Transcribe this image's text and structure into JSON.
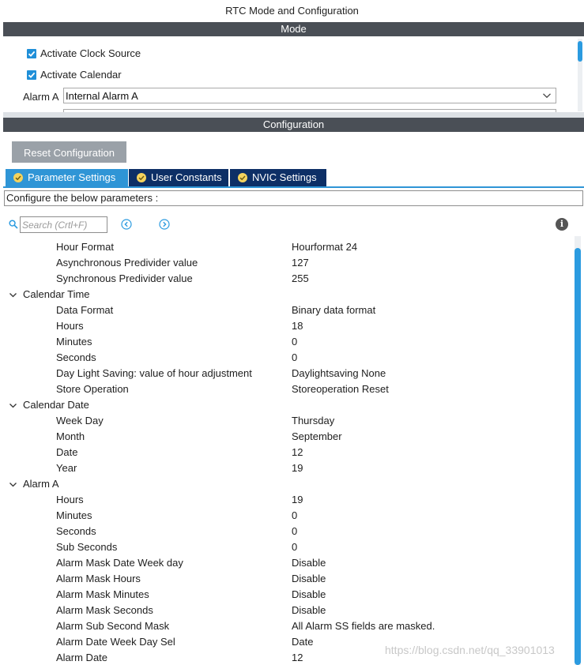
{
  "window": {
    "title": "RTC Mode and Configuration"
  },
  "mode": {
    "header": "Mode",
    "activate_clock_source": {
      "label": "Activate Clock Source",
      "checked": true
    },
    "activate_calendar": {
      "label": "Activate Calendar",
      "checked": true
    },
    "alarm_a": {
      "label": "Alarm A",
      "value": "Internal Alarm A"
    }
  },
  "configuration": {
    "header": "Configuration",
    "reset_label": "Reset Configuration",
    "tabs": [
      {
        "label": "Parameter Settings",
        "active": true
      },
      {
        "label": "User Constants",
        "active": false
      },
      {
        "label": "NVIC Settings",
        "active": false
      }
    ],
    "description": "Configure the below parameters :",
    "search_placeholder": "Search (Crtl+F)"
  },
  "parameters": [
    {
      "type": "item",
      "name": "Hour Format",
      "value": "Hourformat 24"
    },
    {
      "type": "item",
      "name": "Asynchronous Predivider value",
      "value": "127"
    },
    {
      "type": "item",
      "name": "Synchronous Predivider value",
      "value": "255"
    },
    {
      "type": "group",
      "name": "Calendar Time"
    },
    {
      "type": "item",
      "name": "Data Format",
      "value": "Binary data format"
    },
    {
      "type": "item",
      "name": "Hours",
      "value": "18"
    },
    {
      "type": "item",
      "name": "Minutes",
      "value": "0"
    },
    {
      "type": "item",
      "name": "Seconds",
      "value": "0"
    },
    {
      "type": "item",
      "name": "Day Light Saving: value of hour adjustment",
      "value": "Daylightsaving None"
    },
    {
      "type": "item",
      "name": "Store Operation",
      "value": "Storeoperation Reset"
    },
    {
      "type": "group",
      "name": "Calendar Date"
    },
    {
      "type": "item",
      "name": "Week Day",
      "value": "Thursday"
    },
    {
      "type": "item",
      "name": "Month",
      "value": "September"
    },
    {
      "type": "item",
      "name": "Date",
      "value": "12"
    },
    {
      "type": "item",
      "name": "Year",
      "value": "19"
    },
    {
      "type": "group",
      "name": "Alarm A"
    },
    {
      "type": "item",
      "name": "Hours",
      "value": "19"
    },
    {
      "type": "item",
      "name": "Minutes",
      "value": "0"
    },
    {
      "type": "item",
      "name": "Seconds",
      "value": "0"
    },
    {
      "type": "item",
      "name": "Sub Seconds",
      "value": "0"
    },
    {
      "type": "item",
      "name": "Alarm Mask Date Week day",
      "value": "Disable"
    },
    {
      "type": "item",
      "name": "Alarm Mask Hours",
      "value": "Disable"
    },
    {
      "type": "item",
      "name": "Alarm Mask Minutes",
      "value": "Disable"
    },
    {
      "type": "item",
      "name": "Alarm Mask Seconds",
      "value": "Disable"
    },
    {
      "type": "item",
      "name": "Alarm Sub Second Mask",
      "value": "All Alarm SS fields are masked."
    },
    {
      "type": "item",
      "name": "Alarm Date Week Day Sel",
      "value": "Date"
    },
    {
      "type": "item",
      "name": "Alarm Date",
      "value": "12"
    }
  ],
  "watermark": "https://blog.csdn.net/qq_33901013",
  "colors": {
    "accent": "#2b9be0",
    "header_bar": "#4a4f56",
    "tab_active": "#2f95d6",
    "tab_inactive": "#0d2f66",
    "tab_ok": "#f4d35e"
  },
  "icons": {
    "checkbox": "check-icon",
    "dropdown": "chevron-down-icon",
    "search": "search-icon",
    "prev": "prev-arrow-icon",
    "next": "next-arrow-icon",
    "info": "info-icon",
    "group_toggle": "chevron-down-icon",
    "tab_status": "check-circle-icon"
  }
}
